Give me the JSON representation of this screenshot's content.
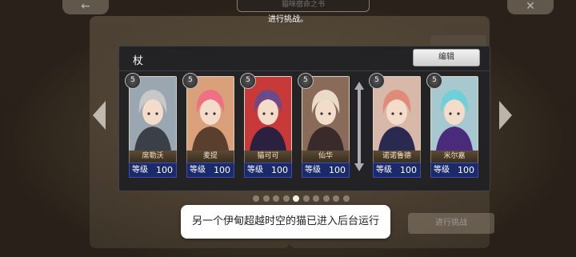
{
  "header": {
    "tab_title": "猫咪宿命之书",
    "hint": "进行挑战。",
    "left_corner_icon": "back-arrow-icon",
    "right_corner_icon": "close-icon"
  },
  "panel": {
    "title": "杖",
    "edit_label": "编辑"
  },
  "cards": [
    {
      "name": "席勒沃",
      "level_label": "等级",
      "level": "100",
      "cost": "5",
      "palette": {
        "hair": "#c8c8c8",
        "bg": "#9aa7b0",
        "cloth": "#3a3f48"
      }
    },
    {
      "name": "麦提",
      "level_label": "等级",
      "level": "100",
      "cost": "5",
      "palette": {
        "hair": "#ef6f84",
        "bg": "#d9a07a",
        "cloth": "#5a3f2e"
      }
    },
    {
      "name": "猫可可",
      "level_label": "等级",
      "level": "100",
      "cost": "5",
      "palette": {
        "hair": "#6b4a8a",
        "bg": "#c83a3a",
        "cloth": "#2b2040"
      }
    },
    {
      "name": "仙华",
      "level_label": "等级",
      "level": "100",
      "cost": "5",
      "palette": {
        "hair": "#e8dcc8",
        "bg": "#8a6a58",
        "cloth": "#3a2a2a"
      }
    },
    {
      "name": "诺诺鲁德",
      "level_label": "等级",
      "level": "100",
      "cost": "5",
      "palette": {
        "hair": "#e08a7a",
        "bg": "#d8b8a8",
        "cloth": "#2a2a50"
      }
    },
    {
      "name": "米尔嘉",
      "level_label": "等级",
      "level": "100",
      "cost": "5",
      "palette": {
        "hair": "#6fd0d8",
        "bg": "#a8c8d0",
        "cloth": "#4a2a7a"
      }
    }
  ],
  "pagination": {
    "count": 10,
    "active": 4
  },
  "toast": "另一个伊甸超越时空的猫已进入后台运行",
  "challenge_button": "进行挑战"
}
